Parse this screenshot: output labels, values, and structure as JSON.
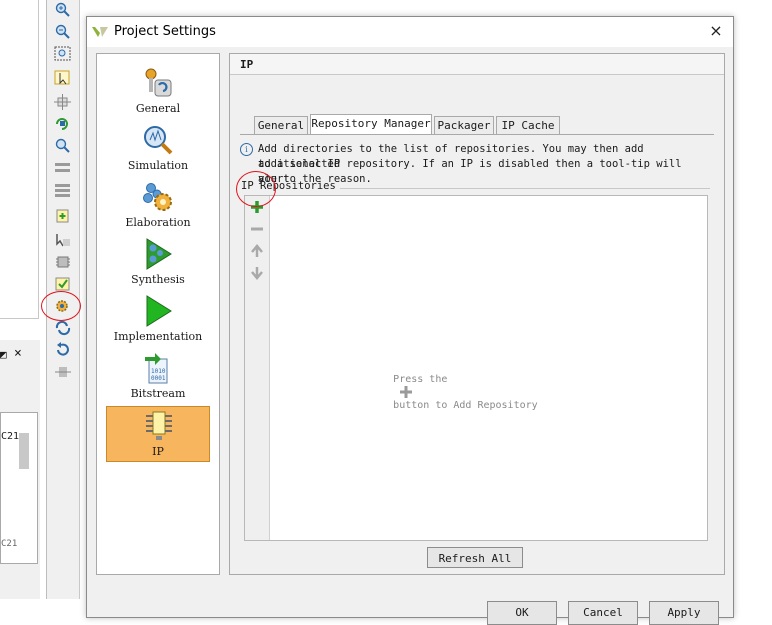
{
  "window": {
    "title": "Project Settings",
    "close_glyph": "×"
  },
  "categories": [
    {
      "label": "General",
      "icon": "general-icon"
    },
    {
      "label": "Simulation",
      "icon": "simulation-icon"
    },
    {
      "label": "Elaboration",
      "icon": "elaboration-icon"
    },
    {
      "label": "Synthesis",
      "icon": "synthesis-icon"
    },
    {
      "label": "Implementation",
      "icon": "implementation-icon"
    },
    {
      "label": "Bitstream",
      "icon": "bitstream-icon"
    },
    {
      "label": "IP",
      "icon": "ip-icon",
      "selected": true
    }
  ],
  "content": {
    "title": "IP",
    "tabs": [
      {
        "label": "General"
      },
      {
        "label": "Repository Manager",
        "active": true
      },
      {
        "label": "Packager"
      },
      {
        "label": "IP Cache"
      }
    ],
    "info_lines": [
      "Add directories to the list of repositories. You may then add additional IP",
      "to a selected repository. If an IP is disabled then a tool-tip will alert",
      "you to the reason."
    ],
    "section_label": "IP Repositories",
    "empty_prefix": "Press the",
    "empty_suffix": "button to Add Repository",
    "refresh_label": "Refresh All"
  },
  "footer": {
    "ok": "OK",
    "cancel": "Cancel",
    "apply": "Apply"
  },
  "background": {
    "lower_panel_close": "×",
    "lower_text_1": "C21",
    "lower_text_2": "C21"
  },
  "colors": {
    "selected_bg": "#f7b55e",
    "accent_green": "#2e9b2e",
    "annotation": "#e2131b"
  }
}
